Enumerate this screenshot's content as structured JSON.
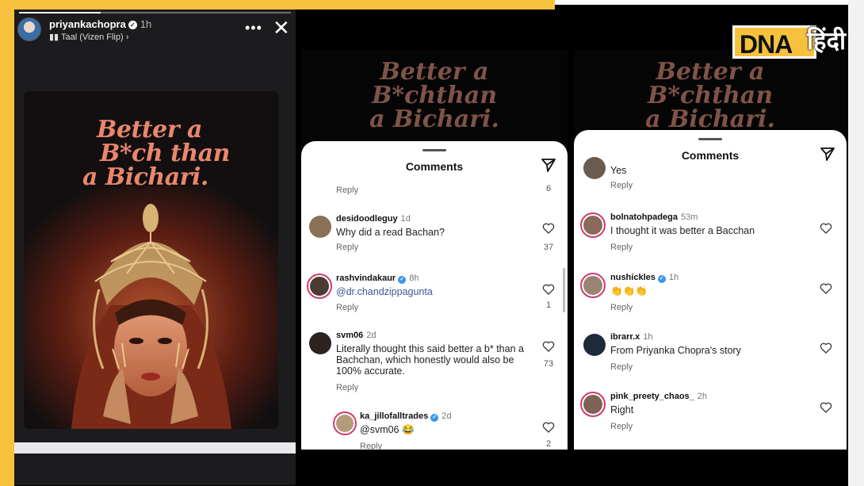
{
  "brand": {
    "logo_latin": "DNA",
    "logo_hindi": "हिंदी",
    "accent": "#f6c23e"
  },
  "story": {
    "username": "priyankachopra",
    "time": "1h",
    "music": "Taal (Vizen Flip)",
    "poster_lines": [
      "Better a",
      "B*ch than",
      "a Bichari."
    ]
  },
  "panel_a": {
    "background_lines": [
      "Better a",
      "B*chthan",
      "a Bichari."
    ],
    "sheet_title": "Comments",
    "top_reply": "Reply",
    "top_likes": "6",
    "comments": [
      {
        "user": "desidoodleguy",
        "time": "1d",
        "verified": false,
        "text": "Why did a read Bachan?",
        "reply": "Reply",
        "likes": "37"
      },
      {
        "user": "rashvindakaur",
        "time": "8h",
        "verified": true,
        "text": "@dr.chandzippagunta",
        "reply": "Reply",
        "likes": "1"
      },
      {
        "user": "svm06",
        "time": "2d",
        "verified": false,
        "text_lines": [
          "Literally thought this said better a b* than a",
          "Bachchan, which honestly would also be",
          "100% accurate."
        ],
        "reply": "Reply",
        "likes": "73"
      },
      {
        "user": "ka_jillofalltrades",
        "time": "2d",
        "verified": true,
        "text": "@svm06 😂",
        "reply": "Reply",
        "likes": "2"
      }
    ]
  },
  "panel_b": {
    "background_lines": [
      "Better a",
      "B*chthan",
      "a Bichari."
    ],
    "sheet_title": "Comments",
    "top_text": "Yes",
    "top_reply": "Reply",
    "comments": [
      {
        "user": "bolnatohpadega",
        "time": "53m",
        "verified": false,
        "text": "I thought it was better a Bacchan",
        "reply": "Reply"
      },
      {
        "user": "nushickles",
        "time": "1h",
        "verified": true,
        "text": "👏👏👏",
        "reply": "Reply"
      },
      {
        "user": "ibrarr.x",
        "time": "1h",
        "verified": false,
        "text": "From Priyanka Chopra's story",
        "reply": "Reply"
      },
      {
        "user": "pink_preety_chaos_",
        "time": "2h",
        "verified": false,
        "text": "Right",
        "reply": "Reply"
      }
    ]
  }
}
